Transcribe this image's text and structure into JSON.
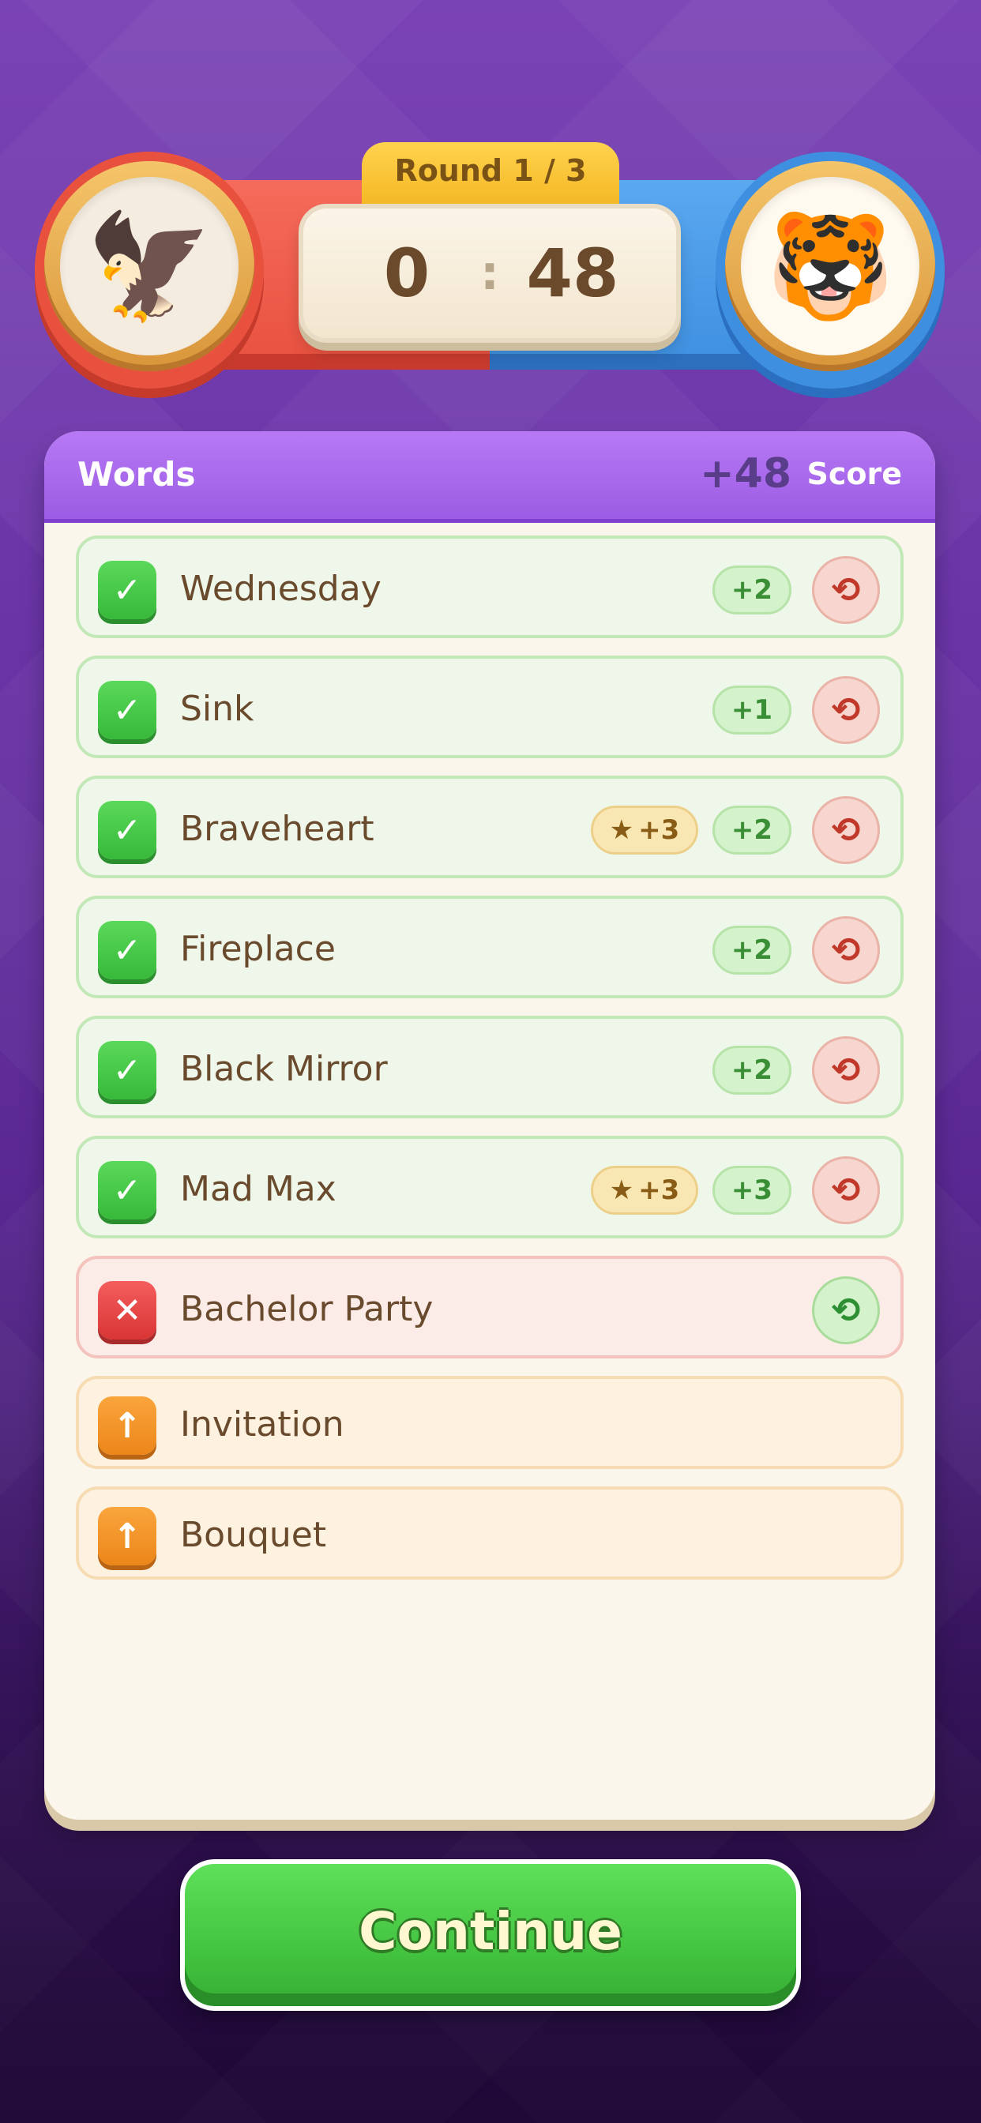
{
  "header": {
    "round_label": "Round 1 / 3",
    "score_left": "0",
    "score_separator": ":",
    "score_right": "48",
    "player_left_avatar": "🦅",
    "player_right_avatar": "🐯"
  },
  "panel": {
    "title": "Words",
    "points": "+48",
    "score_label": "Score"
  },
  "words": [
    {
      "word": "Wednesday",
      "status": "correct",
      "status_icon": "✓",
      "points": "+2",
      "bonus": null,
      "redo_icon": "⟲"
    },
    {
      "word": "Sink",
      "status": "correct",
      "status_icon": "✓",
      "points": "+1",
      "bonus": null,
      "redo_icon": "⟲"
    },
    {
      "word": "Braveheart",
      "status": "correct",
      "status_icon": "✓",
      "points": "+2",
      "bonus": "+3",
      "redo_icon": "⟲"
    },
    {
      "word": "Fireplace",
      "status": "correct",
      "status_icon": "✓",
      "points": "+2",
      "bonus": null,
      "redo_icon": "⟲"
    },
    {
      "word": "Black Mirror",
      "status": "correct",
      "status_icon": "✓",
      "points": "+2",
      "bonus": null,
      "redo_icon": "⟲"
    },
    {
      "word": "Mad Max",
      "status": "correct",
      "status_icon": "✓",
      "points": "+3",
      "bonus": "+3",
      "redo_icon": "⟲"
    },
    {
      "word": "Bachelor Party",
      "status": "wrong",
      "status_icon": "✕",
      "points": null,
      "bonus": null,
      "redo_icon": "⟲"
    },
    {
      "word": "Invitation",
      "status": "pending",
      "status_icon": "↑",
      "points": null,
      "bonus": null,
      "redo_icon": null
    },
    {
      "word": "Bouquet",
      "status": "pending",
      "status_icon": "↑",
      "points": null,
      "bonus": null,
      "redo_icon": null
    }
  ],
  "star_glyph": "★",
  "continue_label": "Continue",
  "colors": {
    "team_left": "#e9513f",
    "team_right": "#3e8fe0",
    "accent_purple": "#9c5ce4",
    "correct_green": "#38b93a",
    "wrong_red": "#d93535",
    "pending_orange": "#ec861a"
  }
}
